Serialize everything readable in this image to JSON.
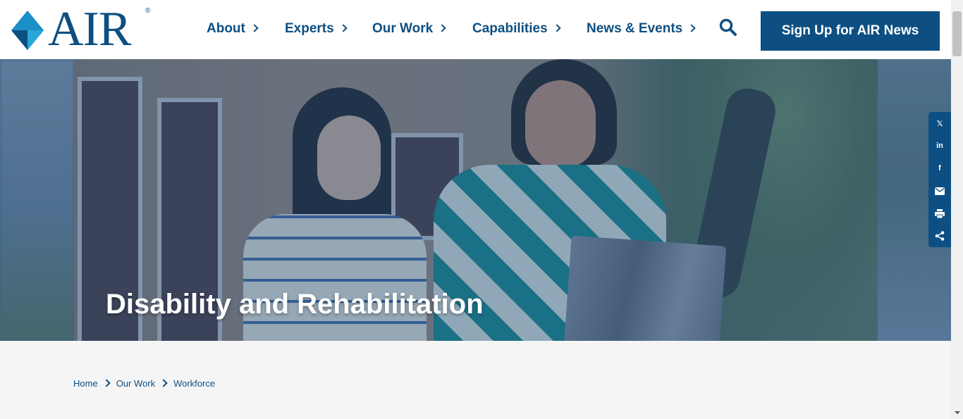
{
  "header": {
    "logo_text": "AIR",
    "logo_reg": "®",
    "nav": [
      {
        "label": "About"
      },
      {
        "label": "Experts"
      },
      {
        "label": "Our Work"
      },
      {
        "label": "Capabilities"
      },
      {
        "label": "News & Events"
      }
    ],
    "search_icon": "search-icon",
    "signup_label": "Sign Up for AIR News"
  },
  "hero": {
    "title": "Disability and Rehabilitation"
  },
  "share": {
    "items": [
      {
        "icon": "x-twitter-icon",
        "label": "𝕏"
      },
      {
        "icon": "linkedin-icon",
        "label": "in"
      },
      {
        "icon": "facebook-icon",
        "label": "f"
      },
      {
        "icon": "email-icon",
        "label": ""
      },
      {
        "icon": "print-icon",
        "label": ""
      },
      {
        "icon": "share-icon",
        "label": ""
      }
    ]
  },
  "breadcrumb": {
    "items": [
      "Home",
      "Our Work",
      "Workforce"
    ]
  },
  "colors": {
    "brand": "#0d4f82",
    "background": "#f5f5f5"
  }
}
